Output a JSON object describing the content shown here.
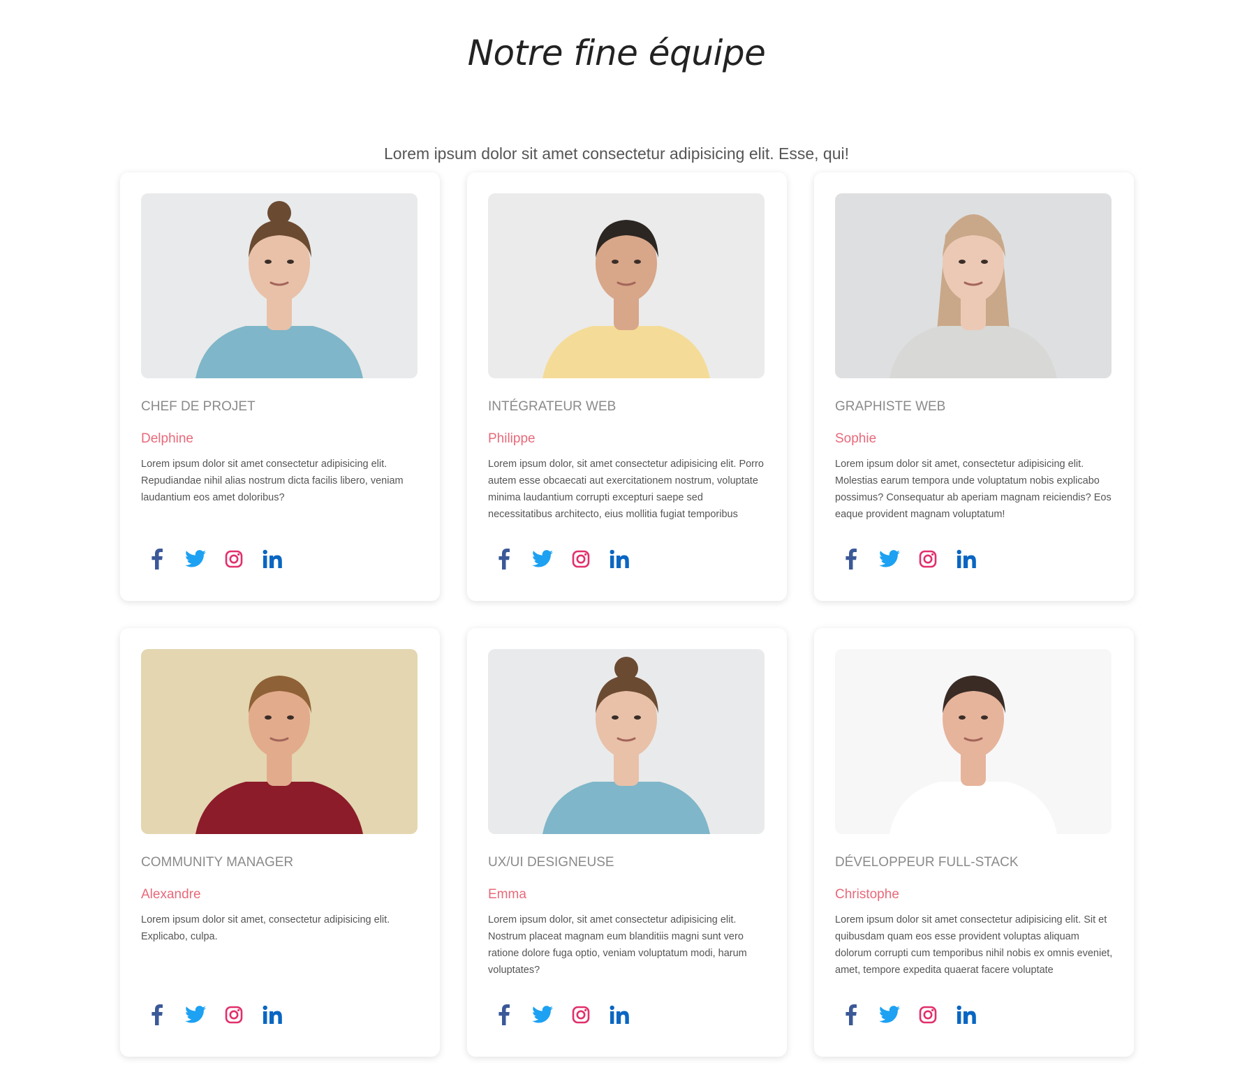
{
  "header": {
    "title": "Notre fine équipe",
    "subtitle": "Lorem ipsum dolor sit amet consectetur adipisicing elit. Esse, qui!"
  },
  "colors": {
    "facebook": "#3b5998",
    "twitter": "#1da1f2",
    "instagram": "#e1306c",
    "linkedin": "#0a66c2",
    "name_accent": "#e8697a"
  },
  "social_icons": [
    "facebook-icon",
    "twitter-icon",
    "instagram-icon",
    "linkedin-icon"
  ],
  "team": [
    {
      "role": "Chef de projet",
      "name": "Delphine",
      "description": "Lorem ipsum dolor sit amet consectetur adipisicing elit. Repudiandae nihil alias nostrum dicta facilis libero, veniam laudantium eos amet doloribus?",
      "photo": "woman-blue-top-photo"
    },
    {
      "role": "Intégrateur web",
      "name": "Philippe",
      "description": "Lorem ipsum dolor, sit amet consectetur adipisicing elit. Porro autem esse obcaecati aut exercitationem nostrum, voluptate minima laudantium corrupti excepturi saepe sed necessitatibus architecto, eius mollitia fugiat temporibus",
      "photo": "man-yellow-shirt-photo"
    },
    {
      "role": "Graphiste web",
      "name": "Sophie",
      "description": "Lorem ipsum dolor sit amet, consectetur adipisicing elit. Molestias earum tempora unde voluptatum nobis explicabo possimus? Consequatur ab aperiam magnam reiciendis? Eos eaque provident magnam voluptatum!",
      "photo": "woman-grey-sweater-photo"
    },
    {
      "role": "Community manager",
      "name": "Alexandre",
      "description": "Lorem ipsum dolor sit amet, consectetur adipisicing elit. Explicabo, culpa.",
      "photo": "man-red-shirt-photo"
    },
    {
      "role": "UX/UI Designeuse",
      "name": "Emma",
      "description": "Lorem ipsum dolor, sit amet consectetur adipisicing elit. Nostrum placeat magnam eum blanditiis magni sunt vero ratione dolore fuga optio, veniam voluptatum modi, harum voluptates?",
      "photo": "woman-blue-top-photo"
    },
    {
      "role": "Développeur full-stack",
      "name": "Christophe",
      "description": "Lorem ipsum dolor sit amet consectetur adipisicing elit. Sit et quibusdam quam eos esse provident voluptas aliquam dolorum corrupti cum temporibus nihil nobis ex omnis eveniet, amet, tempore expedita quaerat facere voluptate",
      "photo": "man-white-shirt-photo"
    }
  ]
}
